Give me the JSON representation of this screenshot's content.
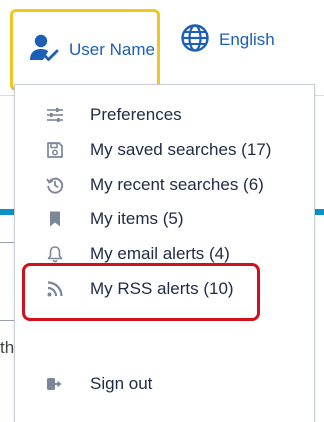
{
  "header": {
    "user_label": "User Name",
    "language_label": "English",
    "accent_color": "#1c5fb8",
    "user_button_border": "#f4c51c"
  },
  "background": {
    "partial_text": "the"
  },
  "menu": {
    "items": [
      {
        "label": "Preferences",
        "icon": "sliders-icon"
      },
      {
        "label": "My saved searches (17)",
        "icon": "floppy-disk-icon"
      },
      {
        "label": "My recent searches (6)",
        "icon": "history-icon"
      },
      {
        "label": "My items (5)",
        "icon": "bookmark-icon"
      },
      {
        "label": "My email alerts (4)",
        "icon": "bell-icon"
      },
      {
        "label": "My RSS alerts (10)",
        "icon": "rss-icon"
      }
    ],
    "sign_out": {
      "label": "Sign out",
      "icon": "sign-out-icon"
    },
    "highlight_color": "#d0101c"
  }
}
